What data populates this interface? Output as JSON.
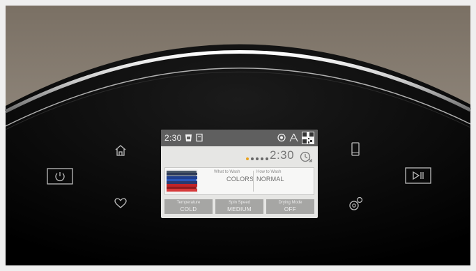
{
  "status_bar": {
    "time": "2:30",
    "icons": [
      "detergent-icon",
      "dispenser-icon",
      "wifi-remote-icon",
      "smart-icon",
      "qr-code-icon"
    ]
  },
  "cycle": {
    "page_dots": 5,
    "active_dot": 1,
    "time_remaining": "2:30",
    "timer_icon": "clock-end-icon"
  },
  "wash_card": {
    "what_label": "What to Wash",
    "what_value": "COLORS",
    "how_label": "How to Wash",
    "how_value": "NORMAL",
    "image": "folded-clothes-image"
  },
  "options": [
    {
      "label": "Temperature",
      "value": "COLD"
    },
    {
      "label": "Spin Speed",
      "value": "MEDIUM"
    },
    {
      "label": "Drying Mode",
      "value": "OFF"
    }
  ],
  "touch_controls": {
    "left": [
      "home-icon",
      "power-icon",
      "favorite-heart-icon"
    ],
    "right": [
      "phone-icon",
      "play-pause-icon",
      "cycle-options-icon"
    ]
  },
  "colors": {
    "screen_bg": "#e6e6e4",
    "status_bar": "#5f5f5f",
    "option_tile": "#a6a6a4",
    "active_dot": "#e8a21e",
    "panel": "#050505"
  }
}
